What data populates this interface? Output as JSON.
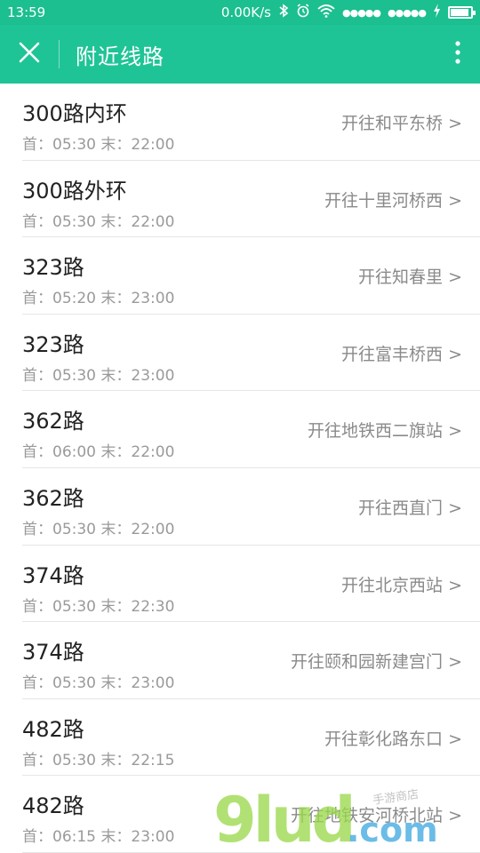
{
  "status_bar": {
    "time": "13:59",
    "network_speed": "0.00K/s",
    "signal_1": "●●●●●",
    "signal_2": "●●●●●",
    "battery_level": 0.9,
    "icons": [
      "bluetooth-icon",
      "alarm-icon",
      "wifi-icon",
      "charging-icon",
      "battery-icon"
    ]
  },
  "app_bar": {
    "title": "附近线路",
    "close_icon": "close-icon",
    "more_icon": "more-vertical-icon"
  },
  "colors": {
    "accent": "#1fc496",
    "status_bar": "#1cbf8f"
  },
  "routes": [
    {
      "name": "300路内环",
      "times": "首：05:30 末：22:00",
      "dest": "开往和平东桥 >"
    },
    {
      "name": "300路外环",
      "times": "首：05:30 末：22:00",
      "dest": "开往十里河桥西 >"
    },
    {
      "name": "323路",
      "times": "首：05:20 末：23:00",
      "dest": "开往知春里 >"
    },
    {
      "name": "323路",
      "times": "首：05:30 末：23:00",
      "dest": "开往富丰桥西 >"
    },
    {
      "name": "362路",
      "times": "首：06:00 末：22:00",
      "dest": "开往地铁西二旗站 >"
    },
    {
      "name": "362路",
      "times": "首：05:30 末：22:00",
      "dest": "开往西直门 >"
    },
    {
      "name": "374路",
      "times": "首：05:30 末：22:30",
      "dest": "开往北京西站 >"
    },
    {
      "name": "374路",
      "times": "首：05:30 末：23:00",
      "dest": "开往颐和园新建宫门 >"
    },
    {
      "name": "482路",
      "times": "首：05:30 末：22:15",
      "dest": "开往彰化路东口 >"
    },
    {
      "name": "482路",
      "times": "首：06:15 末：23:00",
      "dest": "开往地铁安河桥北站 >"
    }
  ],
  "watermark": {
    "logo_text": "9lud.com",
    "stamp_text": "手游商店"
  }
}
